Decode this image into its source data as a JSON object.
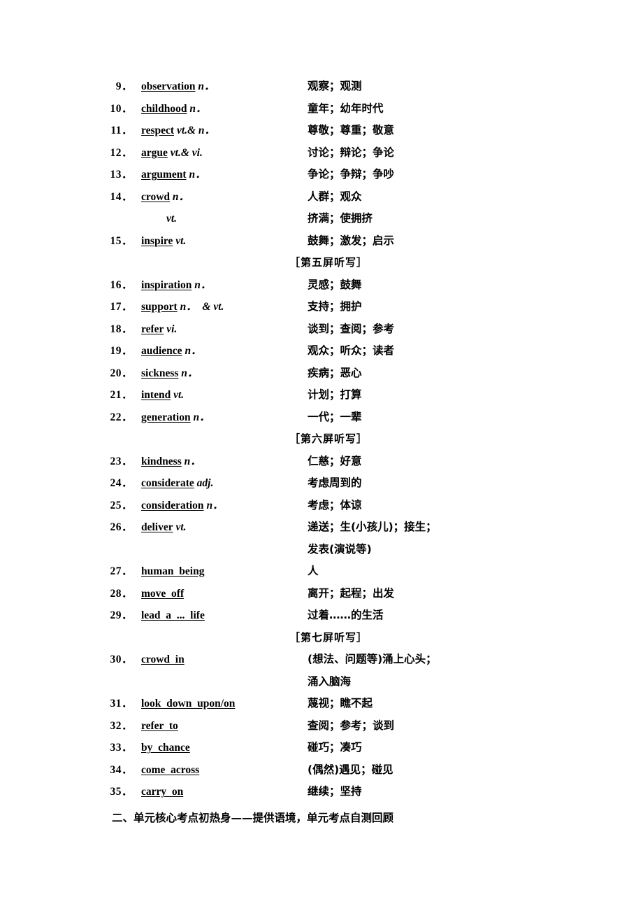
{
  "document": {
    "entries": [
      {
        "kind": "entry",
        "number": "9．",
        "head": "observation",
        "pos": " n．",
        "definition": "观察；观测"
      },
      {
        "kind": "entry",
        "number": "10．",
        "head": "childhood",
        "pos": " n．",
        "definition": "童年；幼年时代"
      },
      {
        "kind": "entry",
        "number": "11．",
        "head": "respect",
        "pos": " vt.& n．",
        "definition": "尊敬；尊重；敬意"
      },
      {
        "kind": "entry",
        "number": "12．",
        "head": "argue",
        "pos": " vt.& vi.",
        "definition": "讨论；辩论；争论"
      },
      {
        "kind": "entry",
        "number": "13．",
        "head": "argument",
        "pos": " n．",
        "definition": "争论；争辩；争吵"
      },
      {
        "kind": "entry",
        "number": "14．",
        "head": "crowd",
        "pos": " n．",
        "definition": "人群；观众"
      },
      {
        "kind": "subline",
        "number": "",
        "head": "",
        "pos": "vt.",
        "definition": "挤满；使拥挤"
      },
      {
        "kind": "entry",
        "number": "15．",
        "head": "inspire",
        "pos": " vt.",
        "definition": "鼓舞；激发；启示"
      },
      {
        "kind": "header",
        "label": "［第五屏听写］"
      },
      {
        "kind": "entry",
        "number": "16．",
        "head": "inspiration",
        "pos": " n．",
        "definition": "灵感；鼓舞"
      },
      {
        "kind": "entry",
        "number": "17．",
        "head": "support",
        "pos": " n．  & vt.",
        "definition": "支持；拥护"
      },
      {
        "kind": "entry",
        "number": "18．",
        "head": "refer",
        "pos": " vi.",
        "definition": "谈到；查阅；参考"
      },
      {
        "kind": "entry",
        "number": "19．",
        "head": "audience",
        "pos": " n．",
        "definition": "观众；听众；读者"
      },
      {
        "kind": "entry",
        "number": "20．",
        "head": "sickness",
        "pos": " n．",
        "definition": "疾病；恶心"
      },
      {
        "kind": "entry",
        "number": "21．",
        "head": "intend",
        "pos": " vt.",
        "definition": "计划；打算"
      },
      {
        "kind": "entry",
        "number": "22．",
        "head": "generation",
        "pos": " n．",
        "definition": "一代；一辈"
      },
      {
        "kind": "header",
        "label": "［第六屏听写］"
      },
      {
        "kind": "entry",
        "number": "23．",
        "head": "kindness",
        "pos": " n．",
        "definition": "仁慈；好意"
      },
      {
        "kind": "entry",
        "number": "24．",
        "head": "considerate",
        "pos": " adj.",
        "definition": "考虑周到的"
      },
      {
        "kind": "entry",
        "number": "25．",
        "head": "consideration",
        "pos": " n．",
        "definition": "考虑；体谅"
      },
      {
        "kind": "entry",
        "number": "26．",
        "head": "deliver",
        "pos": " vt.",
        "definition": "递送；生(小孩儿)；接生；"
      },
      {
        "kind": "continuation",
        "definition": "发表(演说等)"
      },
      {
        "kind": "phrase",
        "number": "27．",
        "head": "human  being",
        "pos": "",
        "definition": "人"
      },
      {
        "kind": "phrase",
        "number": "28．",
        "head": "move  off",
        "pos": "",
        "definition": "离开；起程；出发"
      },
      {
        "kind": "phrase",
        "number": "29．",
        "head": "lead  a  ...  life",
        "pos": "",
        "definition": "过着……的生活"
      },
      {
        "kind": "header",
        "label": "［第七屏听写］"
      },
      {
        "kind": "phrase",
        "number": "30．",
        "head": "crowd  in",
        "pos": "",
        "definition": "(想法、问题等)涌上心头；"
      },
      {
        "kind": "continuation",
        "definition": "涌入脑海"
      },
      {
        "kind": "phrase",
        "number": "31．",
        "head": "look  down  upon/on",
        "pos": "",
        "definition": "蔑视；瞧不起"
      },
      {
        "kind": "phrase",
        "number": "32．",
        "head": "refer  to",
        "pos": "",
        "definition": "查阅；参考；谈到"
      },
      {
        "kind": "phrase",
        "number": "33．",
        "head": "by  chance",
        "pos": "",
        "definition": "碰巧；凑巧"
      },
      {
        "kind": "phrase",
        "number": "34．",
        "head": "come  across",
        "pos": "",
        "definition": "(偶然)遇见；碰见"
      },
      {
        "kind": "phrase",
        "number": "35．",
        "head": "carry  on",
        "pos": "",
        "definition": "继续；坚持"
      }
    ],
    "footer_heading": "二、单元核心考点初热身——提供语境，单元考点自测回顾"
  }
}
